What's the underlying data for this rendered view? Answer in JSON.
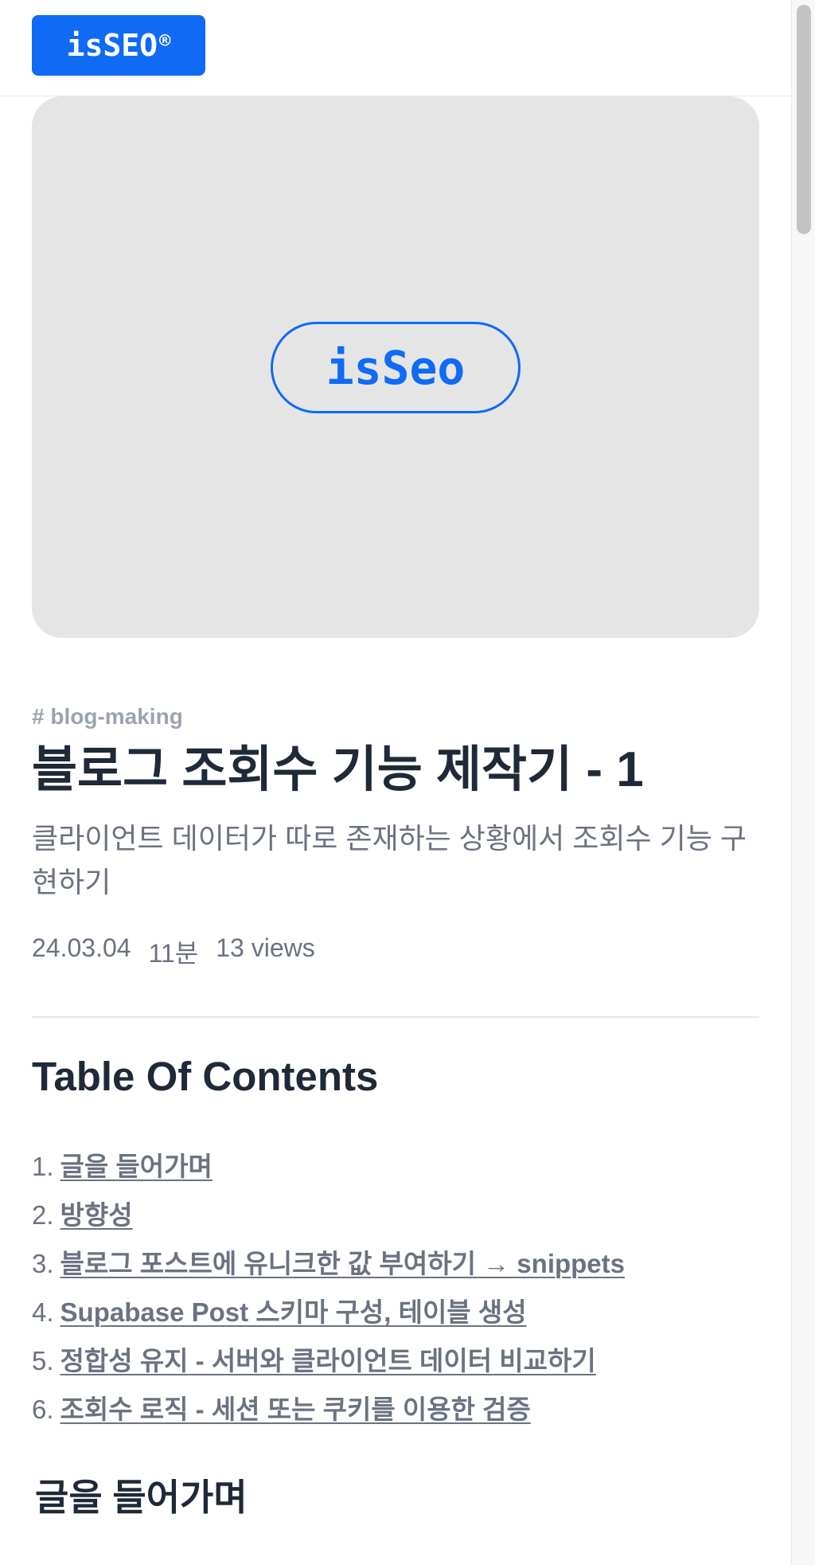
{
  "header": {
    "logo_text": "isSEO",
    "logo_mark": "®",
    "brand_color": "#0f6af5"
  },
  "hero": {
    "badge_text": "isSeo",
    "background": "#e5e5e5"
  },
  "post": {
    "tag": "# blog-making",
    "title": "블로그 조회수 기능 제작기 - 1",
    "subtitle": "클라이언트 데이터가 따로 존재하는 상황에서 조회수 기능 구현하기",
    "date": "24.03.04",
    "read_time": "11분",
    "views": "13 views"
  },
  "toc": {
    "title": "Table Of Contents",
    "items": [
      {
        "number": "1.",
        "label": "글을 들어가며"
      },
      {
        "number": "2.",
        "label": "방향성"
      },
      {
        "number": "3.",
        "label": "블로그 포스트에 유니크한 값 부여하기 → snippets"
      },
      {
        "number": "4.",
        "label": "Supabase Post 스키마 구성, 테이블 생성"
      },
      {
        "number": "5.",
        "label": "정합성 유지 - 서버와 클라이언트 데이터 비교하기"
      },
      {
        "number": "6.",
        "label": "조회수 로직 - 세션 또는 쿠키를 이용한 검증"
      }
    ]
  },
  "section": {
    "heading": "글을 들어가며"
  }
}
